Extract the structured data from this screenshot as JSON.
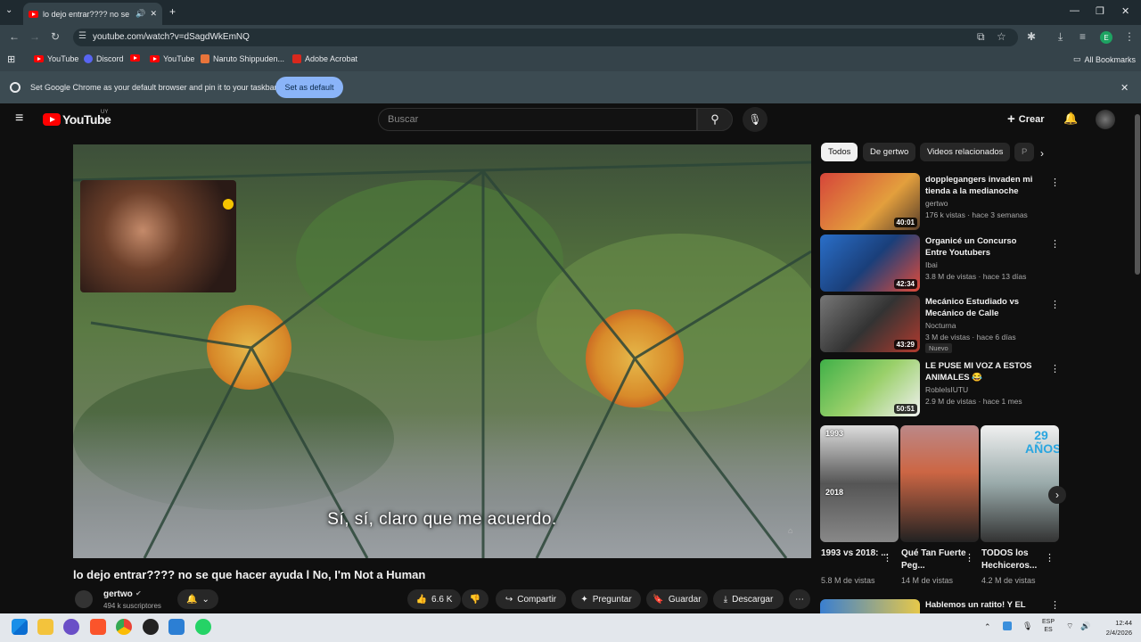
{
  "browser": {
    "tab_title": "lo dejo entrar???? no se que hacer ayuda",
    "url": "youtube.com/watch?v=dSagdWkEmNQ",
    "bookmarks": [
      "YouTube",
      "Discord",
      "YouTube",
      "Naruto Shippuden...",
      "Adobe Acrobat"
    ],
    "all_bookmarks": "All Bookmarks",
    "profile_initial": "E",
    "infobar_text": "Set Google Chrome as your default browser and pin it to your taskbar",
    "infobar_button": "Set as default"
  },
  "youtube": {
    "logo_text": "YouTube",
    "region": "UY",
    "search_placeholder": "Buscar",
    "create_label": "Crear"
  },
  "video": {
    "caption": "Sí, sí, claro que me acuerdo.",
    "title": "lo dejo entrar???? no se que hacer ayuda l No, I'm Not a Human",
    "channel": "gertwo",
    "subscribers": "494 k suscriptores",
    "likes": "6.6 K",
    "share_label": "Compartir",
    "ask_label": "Preguntar",
    "save_label": "Guardar",
    "download_label": "Descargar"
  },
  "chips": [
    "Todos",
    "De gertwo",
    "Videos relacionados",
    "P"
  ],
  "recommendations": [
    {
      "title": "dopplegangers invaden mi tienda a la medianoche",
      "channel": "gertwo",
      "meta": "176 k vistas · hace 3 semanas",
      "duration": "40:01",
      "badge": ""
    },
    {
      "title": "Organicé un Concurso Entre Youtubers",
      "channel": "Ibai",
      "meta": "3.8 M de vistas · hace 13 días",
      "duration": "42:34",
      "badge": ""
    },
    {
      "title": "Mecánico Estudiado vs Mecánico de Calle",
      "channel": "Nocturna",
      "meta": "3 M de vistas · hace 6 días",
      "duration": "43:29",
      "badge": "Nuevo"
    },
    {
      "title": "LE PUSE MI VOZ A ESTOS ANIMALES 😂",
      "channel": "RoblelsIUTU",
      "meta": "2.9 M de vistas · hace 1 mes",
      "duration": "50:51",
      "badge": ""
    }
  ],
  "shorts": [
    {
      "title": "1993 vs 2018: ...",
      "views": "5.8 M de vistas",
      "overlay_top": "1993",
      "overlay_bottom": "2018"
    },
    {
      "title": "Qué Tan Fuerte Peg...",
      "views": "14 M de vistas"
    },
    {
      "title": "TODOS los Hechiceros...",
      "views": "4.2 M de vistas",
      "overlay_top": "29 AÑOS"
    }
  ],
  "next_partial_title": "Hablemos un ratito! Y EL",
  "taskbar": {
    "lang": "ESP",
    "region": "ES",
    "time": "12:44",
    "date": "2/4/2026"
  }
}
